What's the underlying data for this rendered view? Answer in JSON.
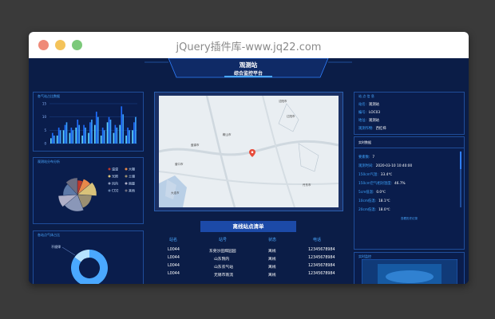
{
  "window": {
    "title": "jQuery插件库-www.jq22.com"
  },
  "header": {
    "title": "观测站",
    "subtitle": "综合监控平台"
  },
  "panels": {
    "bar_title": "各气站占比数据",
    "pie_title": "观测站分布分析",
    "donut_title": "各站点气体占比",
    "station_title": "站 点 信 息",
    "realtime_title": "实时数据",
    "monitor_title": "实时监控"
  },
  "station": {
    "rows": [
      {
        "key": "站名:",
        "value": "观测站"
      },
      {
        "key": "编号:",
        "value": "LOC03"
      },
      {
        "key": "地址:",
        "value": "观测站"
      },
      {
        "key": "观测作物:",
        "value": "西红柿"
      }
    ]
  },
  "realtime": {
    "rows": [
      {
        "key": "要素数:",
        "value": "7"
      },
      {
        "key": "观测时间:",
        "value": "2020-03-10 10:40:00"
      },
      {
        "key": "150cm气温:",
        "value": "33.4℃"
      },
      {
        "key": "150cm空气相对湿度:",
        "value": "46.7%"
      },
      {
        "key": "5cm低温:",
        "value": "0.0℃"
      },
      {
        "key": "10cm低温:",
        "value": "18.1℃"
      },
      {
        "key": "20cm低温:",
        "value": "18.0℃"
      }
    ],
    "more": "查看历史记录"
  },
  "map": {
    "labels": [
      "沈阳市",
      "辽阳市",
      "鞍山市",
      "营口市",
      "盘锦市",
      "丹东市",
      "大连市"
    ]
  },
  "list": {
    "title": "离线站点清单",
    "columns": [
      "站名",
      "站号",
      "状态",
      "电话"
    ],
    "rows": [
      [
        "L0044",
        "东莞沙田辉园园",
        "离线",
        "12345678984"
      ],
      [
        "L0044",
        "山东院内",
        "离线",
        "12345678984"
      ],
      [
        "L0044",
        "山东农气站",
        "离线",
        "12345678984"
      ],
      [
        "L0044",
        "无锡市南流",
        "离线",
        "12345678984"
      ]
    ]
  },
  "chart_data": [
    {
      "type": "bar",
      "title": "各气站占比数据",
      "ylim": [
        0,
        15
      ],
      "yticks": [
        0,
        5,
        10,
        15
      ],
      "series": [
        {
          "values": [
            2,
            3,
            5,
            4,
            6,
            3,
            4,
            7,
            3,
            8,
            4,
            7,
            3,
            5
          ]
        },
        {
          "values": [
            4,
            6,
            7,
            6,
            9,
            7,
            8,
            12,
            6,
            10,
            7,
            14,
            6,
            8
          ]
        },
        {
          "values": [
            3,
            5,
            8,
            5,
            7,
            6,
            9,
            10,
            5,
            9,
            6,
            11,
            5,
            10
          ]
        }
      ],
      "colors": [
        "#5fd3ff",
        "#1e6dff",
        "#3aa0ff"
      ]
    },
    {
      "type": "pie",
      "title": "观测站分布分析",
      "legend": [
        "温湿",
        "大棚",
        "光照",
        "土壤",
        "风向",
        "雨量",
        "CO2",
        "其他"
      ],
      "values": [
        6,
        8,
        12,
        18,
        20,
        10,
        14,
        12
      ],
      "colors": [
        "#c0392b",
        "#e8894a",
        "#d9c27a",
        "#9b8f72",
        "#8a97b8",
        "#b0b0c8",
        "#5e7aa8",
        "#6d6d80"
      ]
    },
    {
      "type": "pie",
      "title": "各站点气体占比",
      "legend": [
        "不规律"
      ],
      "values": [
        85,
        15
      ],
      "colors": [
        "#4aa8ff",
        "#b7e3ff"
      ]
    }
  ]
}
